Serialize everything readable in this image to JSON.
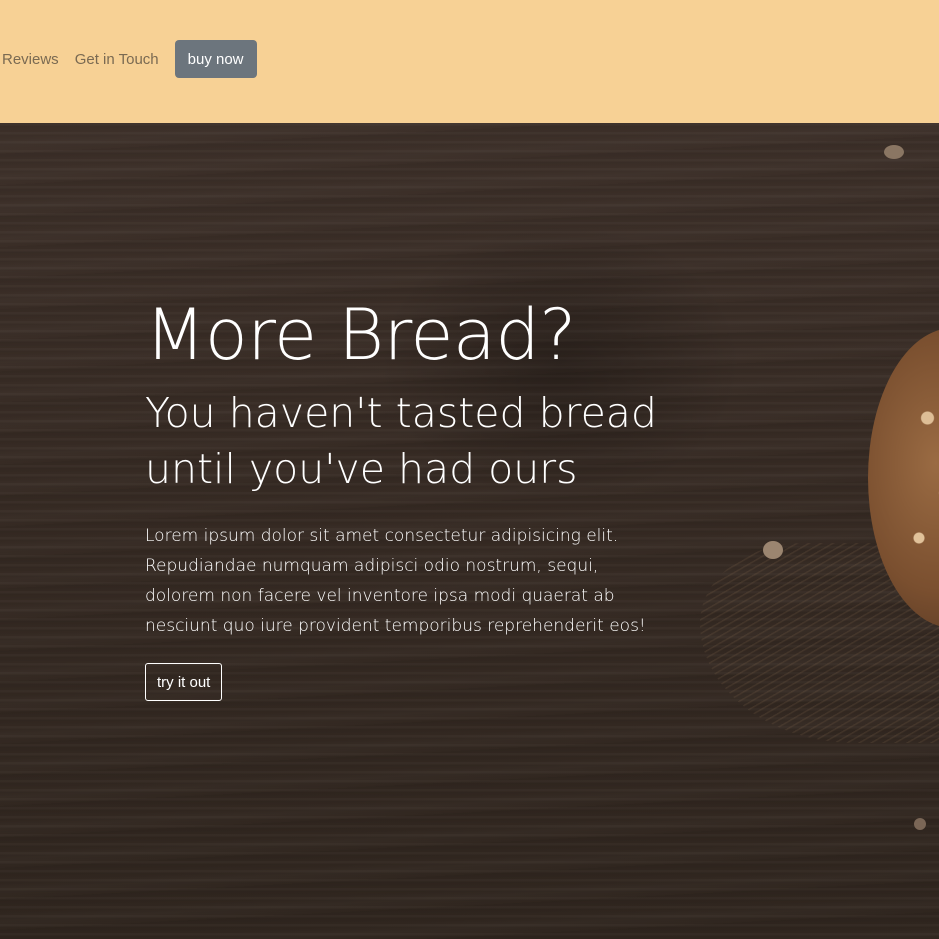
{
  "navbar": {
    "links": [
      "Reviews",
      "Get in Touch"
    ],
    "cta_label": "buy now",
    "background_color": "#f7d195"
  },
  "hero": {
    "title": "More Bread?",
    "subtitle": "You haven't tasted bread until you've had ours",
    "body": "Lorem ipsum dolor sit amet consectetur adipisicing elit. Repudiandae numquam adipisci odio nostrum, sequi, dolorem non facere vel inventore ipsa modi quaerat ab nesciunt quo iure provident temporibus reprehenderit eos!",
    "button_label": "try it out",
    "background_color": "#3a2e27"
  }
}
